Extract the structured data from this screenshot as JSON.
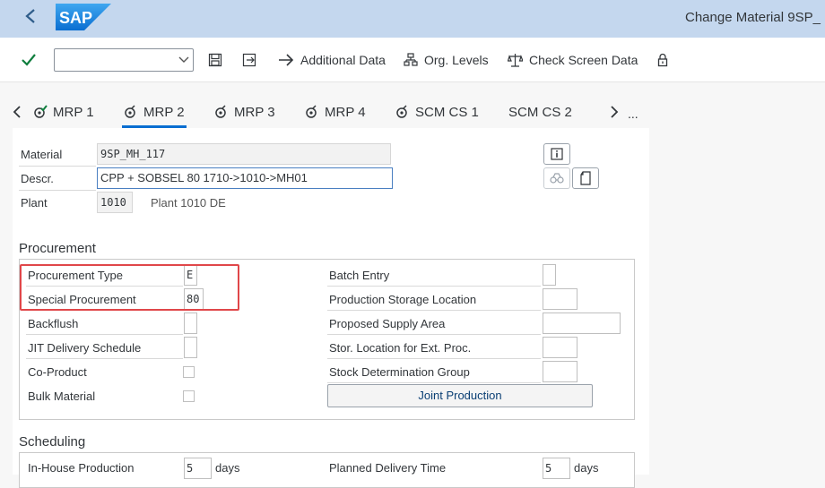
{
  "shell": {
    "title": "Change Material 9SP_",
    "logo_text": "SAP"
  },
  "toolbar": {
    "additional_data": "Additional Data",
    "org_levels": "Org. Levels",
    "check_screen_data": "Check Screen Data",
    "command_value": ""
  },
  "tabs": [
    {
      "label": "MRP 1"
    },
    {
      "label": "MRP 2"
    },
    {
      "label": "MRP 3"
    },
    {
      "label": "MRP 4"
    },
    {
      "label": "SCM CS 1"
    },
    {
      "label": "SCM CS 2"
    }
  ],
  "tabs_more": "...",
  "header": {
    "material_label": "Material",
    "material_value": "9SP_MH_117",
    "descr_label": "Descr.",
    "descr_value": "CPP + SOBSEL 80 1710->1010->MH01",
    "plant_label": "Plant",
    "plant_value": "1010",
    "plant_desc": "Plant 1010 DE"
  },
  "procurement": {
    "title": "Procurement",
    "procurement_type_label": "Procurement Type",
    "procurement_type_value": "E",
    "special_procurement_label": "Special Procurement",
    "special_procurement_value": "80",
    "backflush_label": "Backflush",
    "jit_label": "JIT Delivery Schedule",
    "coproduct_label": "Co-Product",
    "bulk_label": "Bulk Material",
    "batch_entry_label": "Batch Entry",
    "prod_storage_label": "Production Storage Location",
    "supply_area_label": "Proposed Supply Area",
    "ext_proc_label": "Stor. Location for Ext. Proc.",
    "stock_det_label": "Stock Determination Group",
    "joint_production_button": "Joint Production"
  },
  "scheduling": {
    "title": "Scheduling",
    "inhouse_label": "In-House Production",
    "inhouse_value": "5",
    "inhouse_unit": "days",
    "planned_delivery_label": "Planned Delivery Time",
    "planned_delivery_value": "5",
    "planned_delivery_unit": "days"
  },
  "colors": {
    "shell": "#c4d7ee",
    "accent": "#0a6ed1",
    "highlight": "#e0474a",
    "check": "#107e3e"
  }
}
